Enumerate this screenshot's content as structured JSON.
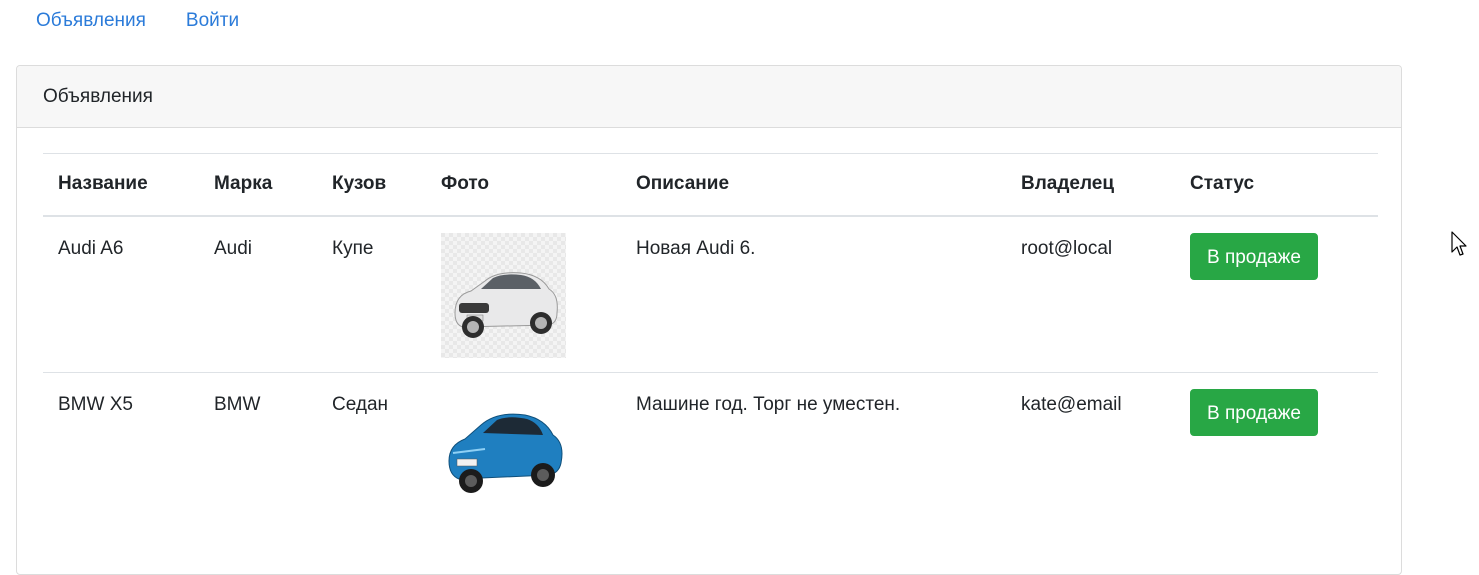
{
  "nav": {
    "items": [
      {
        "label": "Объявления"
      },
      {
        "label": "Войти"
      }
    ]
  },
  "card": {
    "title": "Объявления"
  },
  "table": {
    "headers": [
      "Название",
      "Марка",
      "Кузов",
      "Фото",
      "Описание",
      "Владелец",
      "Статус"
    ],
    "rows": [
      {
        "name": "Audi A6",
        "brand": "Audi",
        "body": "Купе",
        "photo": "white-car-photo",
        "description": "Новая Audi 6.",
        "owner": "root@local",
        "status": "В продаже"
      },
      {
        "name": "BMW X5",
        "brand": "BMW",
        "body": "Седан",
        "photo": "blue-car-photo",
        "description": "Машине год. Торг не уместен.",
        "owner": "kate@email",
        "status": "В продаже"
      }
    ]
  },
  "colors": {
    "link": "#2b7bd9",
    "status_button": "#28a745",
    "header_bg": "#f7f7f7"
  }
}
